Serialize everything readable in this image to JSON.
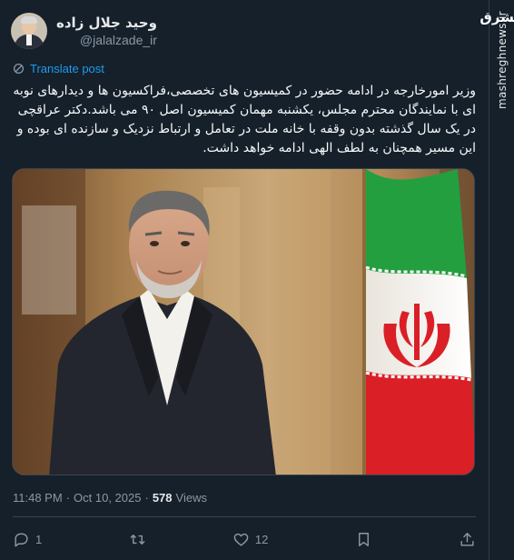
{
  "header": {
    "display_name": "وحید جلال زاده",
    "handle": "@jalalzade_ir"
  },
  "translate_label": "Translate post",
  "post": {
    "text": "وزیر امورخارجه در ادامه حضور در کمیسیون های تخصصی،فراکسیون ها و دیدارهای نوبه ای با نمایندگان محترم مجلس، یکشنبه مهمان کمیسیون اصل ۹۰ می باشد.دکتر عراقچی در یک سال گذشته بدون وقفه با خانه ملت در تعامل و ارتباط نزدیک و سازنده ای بوده و این مسیر همچنان به لطف الهی ادامه خواهد داشت."
  },
  "meta": {
    "time": "11:48 PM",
    "date": "Oct 10, 2025",
    "views_count": "578",
    "views_label": "Views"
  },
  "actions": {
    "reply_count": "1",
    "like_count": "12"
  },
  "watermark": {
    "logo_text": "مشرق",
    "site": "mashreghnews.ir"
  },
  "colors": {
    "background": "#15202b",
    "accent": "#1d9bf0",
    "muted": "#8b98a5",
    "border": "#38444d"
  }
}
